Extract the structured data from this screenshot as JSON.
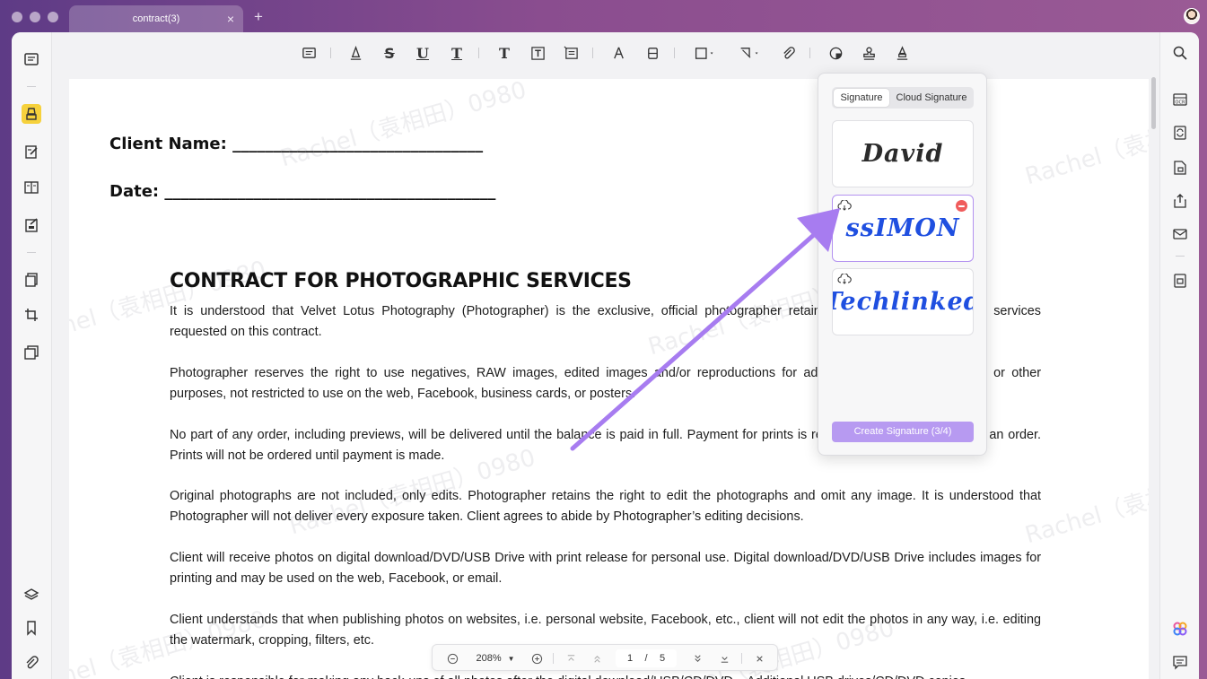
{
  "titlebar": {
    "tab_label": "contract(3)",
    "tab_close": "×",
    "tab_add": "+"
  },
  "document": {
    "client_name_label": "Client Name: _______________________________",
    "date_label": "Date: _________________________________________",
    "title": "CONTRACT FOR PHOTOGRAPHIC SERVICES",
    "paragraphs": [
      "It is understood that Velvet Lotus Photography (Photographer) is the exclusive, official photographer retained to perform photographic services requested on this contract.",
      "Photographer reserves the right to use negatives, RAW images, edited images and/or reproductions for advertising, display, publication or other purposes, not restricted to use on the web, Facebook, business cards, or posters.",
      "No part of any order, including previews, will be delivered until the balance is paid in full. Payment for prints is required at the time of placing an order. Prints will not be ordered until payment is made.",
      "Original photographs are not included, only edits. Photographer retains the right to edit the photographs and omit any image. It is understood that Photographer will not deliver every exposure taken. Client agrees to abide by Photographer’s editing decisions.",
      "Client will receive photos on digital download/DVD/USB Drive with print release for personal use. Digital download/DVD/USB Drive includes images for printing and may be used on the web, Facebook, or email.",
      "Client understands that when publishing photos on websites, i.e. personal website, Facebook, etc., client will not edit the photos in any way, i.e. editing the watermark, cropping, filters, etc.",
      "Client is responsible for making any back-ups of all photos after the digital download/USB/CD/DVD... Additional USB drives/CD/DVD copies..."
    ],
    "watermark_text": "Rachel（袁相田）0980"
  },
  "signature_panel": {
    "tab_signature": "Signature",
    "tab_cloud": "Cloud Signature",
    "signatures": [
      {
        "text": "David",
        "color": "#2b2b2b",
        "cloud": false,
        "selected": false
      },
      {
        "text": "ssIMON",
        "color": "#1f4fe0",
        "cloud": true,
        "selected": true
      },
      {
        "text": "Techlinked",
        "color": "#1f4fe0",
        "cloud": true,
        "selected": false
      }
    ],
    "create_button": "Create Signature (3/4)"
  },
  "bottombar": {
    "zoom": "208%",
    "current_page": "1",
    "page_separator": "/",
    "total_pages": "5"
  },
  "colors": {
    "accent": "#b79af1",
    "arrow": "#a77cf0",
    "highlight_tool": "#f6d13c"
  }
}
